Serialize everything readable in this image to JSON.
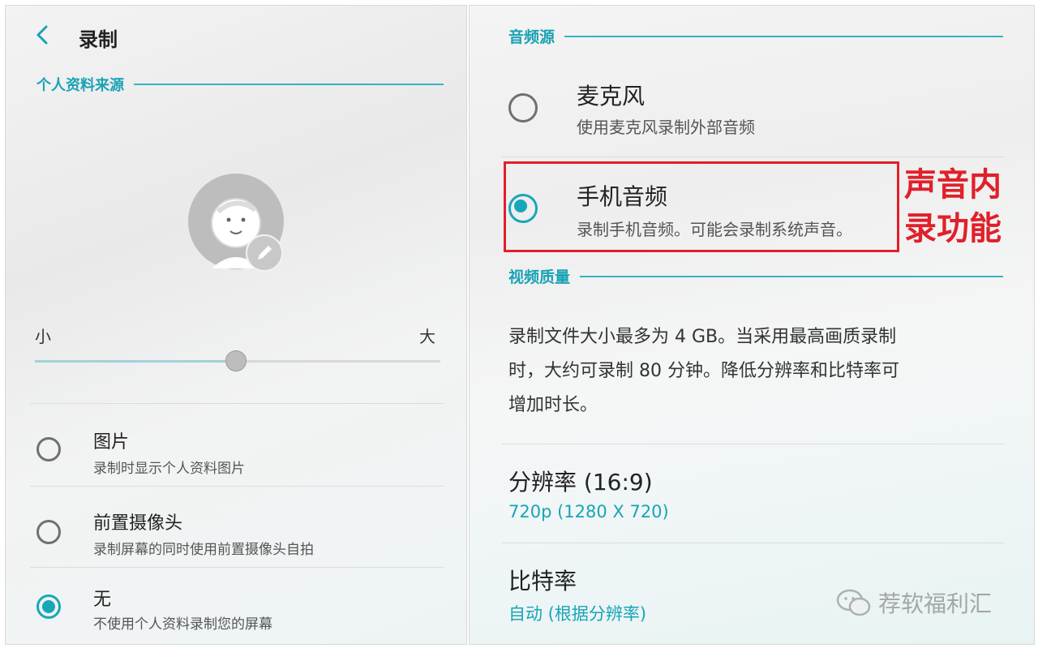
{
  "left": {
    "header": {
      "title": "录制"
    },
    "profile_section": {
      "heading": "个人资料来源"
    },
    "slider": {
      "min_label": "小",
      "max_label": "大",
      "value_fraction": 0.5
    },
    "options": [
      {
        "title": "图片",
        "subtitle": "录制时显示个人资料图片",
        "selected": false
      },
      {
        "title": "前置摄像头",
        "subtitle": "录制屏幕的同时使用前置摄像头自拍",
        "selected": false
      },
      {
        "title": "无",
        "subtitle": "不使用个人资料录制您的屏幕",
        "selected": true
      }
    ]
  },
  "right": {
    "audio_section": {
      "heading": "音频源"
    },
    "audio_options": [
      {
        "title": "麦克风",
        "subtitle": "使用麦克风录制外部音频",
        "selected": false
      },
      {
        "title": "手机音频",
        "subtitle": "录制手机音频。可能会录制系统声音。",
        "selected": true
      }
    ],
    "annotation": {
      "line1": "声音内",
      "line2": "录功能",
      "color": "#e0202a"
    },
    "video_section": {
      "heading": "视频质量",
      "description_line1": "录制文件大小最多为 4 GB。当采用最高画质录制",
      "description_line2": "时，大约可录制 80 分钟。降低分辨率和比特率可",
      "description_line3": "增加时长。"
    },
    "resolution": {
      "title": "分辨率 (16:9)",
      "value": "720p (1280 X 720)"
    },
    "bitrate": {
      "title": "比特率",
      "value": "自动 (根据分辨率)"
    },
    "watermark": {
      "text": "荐软福利汇"
    }
  },
  "accent_color": "#17a7b8"
}
